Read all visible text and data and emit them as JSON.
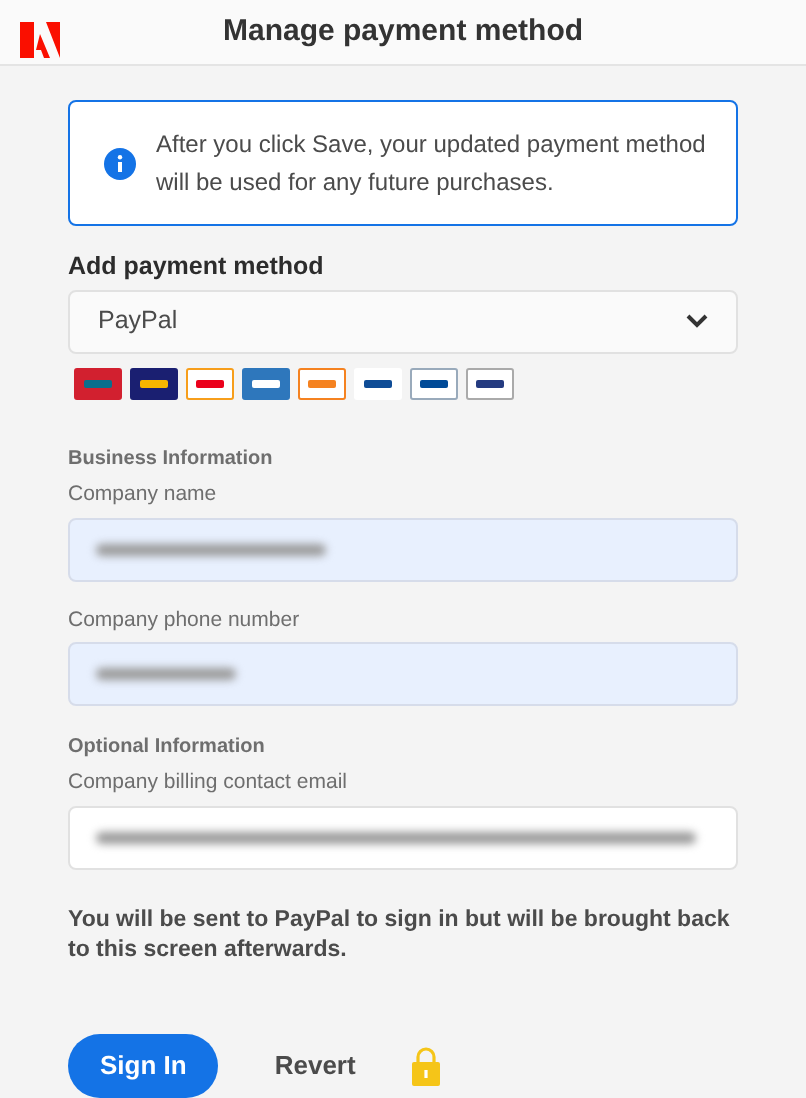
{
  "header": {
    "title": "Manage payment method"
  },
  "notice": {
    "text": "After you click Save, your updated payment method will be used for any future purchases."
  },
  "payment": {
    "label": "Add payment method",
    "value": "PayPal"
  },
  "sections": [
    {
      "heading": "Business Information",
      "fields": [
        {
          "label": "Company name",
          "autofilled": true
        },
        {
          "label": "Company phone number",
          "autofilled": true
        }
      ]
    },
    {
      "heading": "Optional Information",
      "fields": [
        {
          "label": "Company billing contact email",
          "autofilled": false
        }
      ]
    }
  ],
  "note": "You will be sent to PayPal to sign in but will be brought back to this screen afterwards.",
  "buttons": [
    {
      "label": "Sign In",
      "kind": "primary"
    },
    {
      "label": "Revert",
      "kind": "quiet"
    }
  ]
}
